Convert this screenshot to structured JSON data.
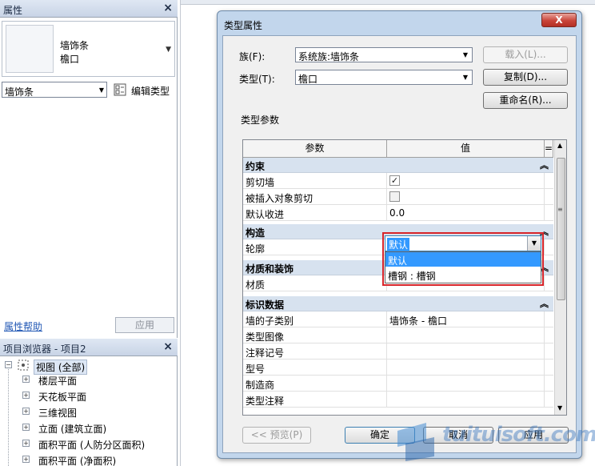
{
  "properties_panel": {
    "title": "属性",
    "close": "×",
    "type_family": "墙饰条",
    "type_name": "檐口",
    "instance_combo": "墙饰条",
    "edit_type": "编辑类型",
    "help_link": "属性帮助",
    "apply": "应用"
  },
  "project_browser": {
    "title": "项目浏览器 - 项目2",
    "close": "×",
    "root": "视图 (全部)",
    "items": [
      "楼层平面",
      "天花板平面",
      "三维视图",
      "立面 (建筑立面)",
      "面积平面 (人防分区面积)",
      "面积平面 (净面积)"
    ]
  },
  "dialog": {
    "title": "类型属性",
    "close": "X",
    "family_label": "族(F):",
    "family_value": "系统族:墙饰条",
    "type_label": "类型(T):",
    "type_value": "檐口",
    "load_btn": "载入(L)...",
    "duplicate_btn": "复制(D)...",
    "rename_btn": "重命名(R)...",
    "type_params_label": "类型参数",
    "col_param": "参数",
    "col_value": "值",
    "col_eq": "=",
    "groups": [
      {
        "name": "约束",
        "rows": [
          {
            "param": "剪切墙",
            "value": "",
            "checkbox": true,
            "checked": true
          },
          {
            "param": "被插入对象剪切",
            "value": "",
            "checkbox": true,
            "checked": false
          },
          {
            "param": "默认收进",
            "value": "0.0"
          }
        ]
      },
      {
        "name": "构造",
        "rows": [
          {
            "param": "轮廓",
            "value": ""
          }
        ]
      },
      {
        "name": "材质和装饰",
        "rows": [
          {
            "param": "材质",
            "value": ""
          }
        ]
      },
      {
        "name": "标识数据",
        "rows": [
          {
            "param": "墙的子类别",
            "value": "墙饰条 - 檐口"
          },
          {
            "param": "类型图像",
            "value": ""
          },
          {
            "param": "注释记号",
            "value": ""
          },
          {
            "param": "型号",
            "value": ""
          },
          {
            "param": "制造商",
            "value": ""
          },
          {
            "param": "类型注释",
            "value": ""
          }
        ]
      }
    ],
    "profile_dropdown": {
      "selected": "默认",
      "options": [
        "默认",
        "槽钢 : 槽钢"
      ]
    },
    "preview_btn": "<< 预览(P)",
    "ok_btn": "确定",
    "cancel_btn": "取消",
    "apply_btn": "应用"
  },
  "watermark": "tuituisoft.com",
  "colors": {
    "accent": "#3399ff",
    "highlight_border": "#d8252a",
    "dialog_frame": "#c2d6ec"
  }
}
